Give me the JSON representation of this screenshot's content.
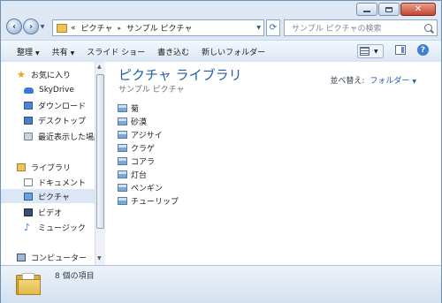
{
  "window": {
    "caption": {
      "minimize": "minimize",
      "maximize": "maximize",
      "close": "✕"
    }
  },
  "address_bar": {
    "overflow": "«",
    "segments": [
      "ピクチャ",
      "サンプル ピクチャ"
    ],
    "separator": "▸"
  },
  "search": {
    "placeholder": "サンプル ピクチャの検索"
  },
  "toolbar": {
    "organize": "整理",
    "share": "共有",
    "slideshow": "スライド ショー",
    "burn": "書き込む",
    "new_folder": "新しいフォルダー",
    "help": "?"
  },
  "sidebar": {
    "items": [
      {
        "label": "お気に入り",
        "icon": "star-icon"
      },
      {
        "label": "SkyDrive",
        "icon": "skydrive-icon"
      },
      {
        "label": "ダウンロード",
        "icon": "downloads-icon"
      },
      {
        "label": "デスクトップ",
        "icon": "desktop-icon"
      },
      {
        "label": "最近表示した場所",
        "icon": "recent-places-icon"
      },
      {
        "label": "ライブラリ",
        "icon": "libraries-icon"
      },
      {
        "label": "ドキュメント",
        "icon": "documents-icon"
      },
      {
        "label": "ピクチャ",
        "icon": "pictures-icon",
        "selected": true
      },
      {
        "label": "ビデオ",
        "icon": "videos-icon"
      },
      {
        "label": "ミュージック",
        "icon": "music-icon"
      },
      {
        "label": "コンピューター",
        "icon": "computer-icon"
      }
    ]
  },
  "main": {
    "library_title": "ピクチャ ライブラリ",
    "library_subtitle": "サンプル ピクチャ",
    "arrange_label": "並べ替え:",
    "arrange_value": "フォルダー",
    "files": [
      "菊",
      "砂漠",
      "アジサイ",
      "クラゲ",
      "コアラ",
      "灯台",
      "ペンギン",
      "チューリップ"
    ]
  },
  "details": {
    "item_count": "8 個の項目"
  },
  "colors": {
    "accent": "#1e5fa8",
    "window_frame": "#dde8f4",
    "selection": "#dce7f5"
  }
}
